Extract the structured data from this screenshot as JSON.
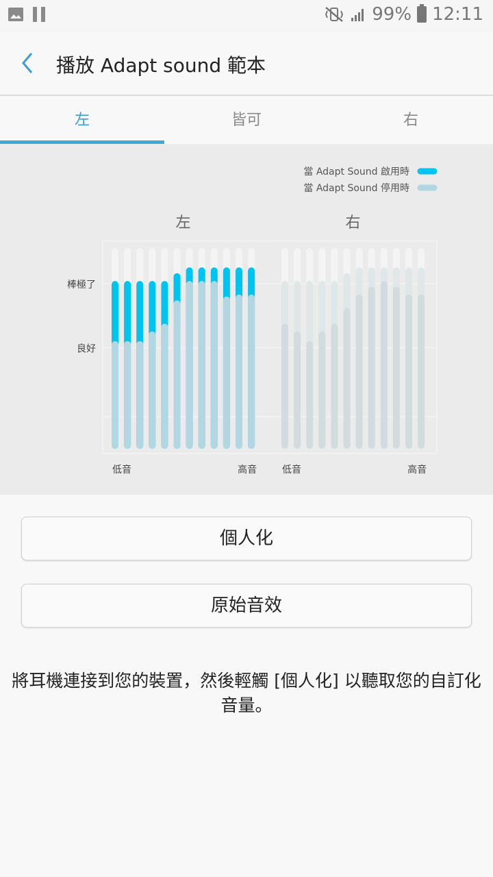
{
  "status_bar": {
    "battery": "99%",
    "time": "12:11",
    "icons": [
      "picture-icon",
      "pause-icon",
      "mute-vibrate-icon",
      "signal-icon",
      "battery-icon"
    ]
  },
  "header": {
    "back_icon": "chevron-left-icon",
    "title": "播放 Adapt sound 範本"
  },
  "tabs": [
    {
      "label": "左",
      "active": true
    },
    {
      "label": "皆可",
      "active": false
    },
    {
      "label": "右",
      "active": false
    }
  ],
  "chart_data": {
    "type": "bar",
    "legend": [
      {
        "label": "當 Adapt Sound 啟用時",
        "color": "#00c4f0"
      },
      {
        "label": "當 Adapt Sound 停用時",
        "color": "#b1d8e2"
      }
    ],
    "legend_position": "top-right",
    "ylim": [
      0,
      100
    ],
    "y_tick_labels": [
      "棒極了",
      "良好"
    ],
    "y_tick_values": [
      83,
      50
    ],
    "x_start_label": "低音",
    "x_end_label": "高音",
    "panels": [
      {
        "name": "左",
        "active": true,
        "enabled": [
          83,
          83,
          83,
          83,
          83,
          87,
          90,
          90,
          90,
          90,
          90,
          90
        ],
        "disabled": [
          52,
          52,
          52,
          57,
          61,
          73,
          83,
          83,
          83,
          75,
          76,
          76
        ]
      },
      {
        "name": "右",
        "active": false,
        "enabled": [
          83,
          83,
          83,
          83,
          83,
          87,
          90,
          90,
          90,
          90,
          90,
          90
        ],
        "disabled": [
          61,
          57,
          52,
          57,
          61,
          69,
          76,
          80,
          83,
          80,
          76,
          76
        ]
      }
    ]
  },
  "buttons": {
    "personalize": "個人化",
    "original": "原始音效"
  },
  "hint_text": "將耳機連接到您的裝置，然後輕觸 [個人化] 以聽取您的自訂化音量。",
  "colors": {
    "accent": "#3ea9d8",
    "enabled_bar": "#00c4f0",
    "disabled_bar": "#b1d8e2",
    "inactive_enabled": "#dfe7e9",
    "inactive_disabled": "#d2dcde",
    "track": "#f4f4f4"
  }
}
